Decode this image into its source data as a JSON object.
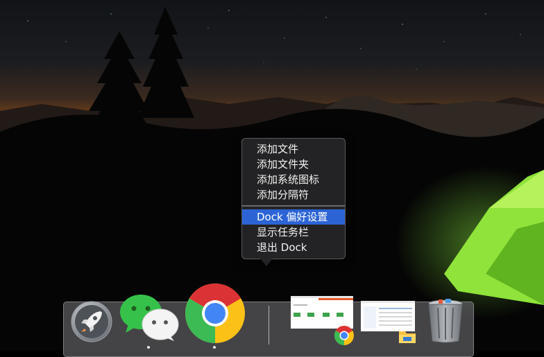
{
  "context_menu": {
    "items": [
      {
        "label": "添加文件"
      },
      {
        "label": "添加文件夹"
      },
      {
        "label": "添加系统图标"
      },
      {
        "label": "添加分隔符"
      }
    ],
    "items_after_separator": [
      {
        "label": "Dock 偏好设置",
        "highlighted": true
      },
      {
        "label": "显示任务栏"
      },
      {
        "label": "退出 Dock"
      }
    ]
  },
  "dock": {
    "apps": [
      {
        "name": "Launchpad",
        "icon": "rocket-icon",
        "running": false
      },
      {
        "name": "WeChat",
        "icon": "wechat-icon",
        "running": true
      },
      {
        "name": "Google Chrome",
        "icon": "chrome-icon",
        "running": true
      }
    ],
    "windows": [
      {
        "app_icon": "chrome-icon"
      },
      {
        "app_icon": "file-explorer-icon"
      }
    ],
    "trash": {
      "icon": "trash-icon"
    }
  },
  "colors": {
    "menu_highlight": "#2c64d6",
    "tent_green": "#8fe33a"
  }
}
